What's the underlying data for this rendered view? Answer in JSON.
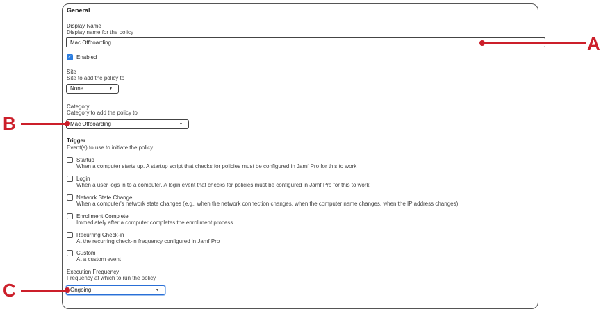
{
  "general": {
    "heading": "General",
    "display_name": {
      "label": "Display Name",
      "description": "Display name for the policy",
      "value": "Mac Offboarding"
    },
    "enabled": {
      "label": "Enabled",
      "checked": true
    },
    "site": {
      "label": "Site",
      "description": "Site to add the policy to",
      "selected": "None"
    },
    "category": {
      "label": "Category",
      "description": "Category to add the policy to",
      "selected": "Mac Offboarding"
    },
    "trigger": {
      "heading": "Trigger",
      "description": "Event(s) to use to initiate the policy",
      "options": [
        {
          "label": "Startup",
          "description": "When a computer starts up. A startup script that checks for policies must be configured in Jamf Pro for this to work",
          "checked": false
        },
        {
          "label": "Login",
          "description": "When a user logs in to a computer. A login event that checks for policies must be configured in Jamf Pro for this to work",
          "checked": false
        },
        {
          "label": "Network State Change",
          "description": "When a computer's network state changes (e.g., when the network connection changes, when the computer name changes, when the IP address changes)",
          "checked": false
        },
        {
          "label": "Enrollment Complete",
          "description": "Immediately after a computer completes the enrollment process",
          "checked": false
        },
        {
          "label": "Recurring Check-in",
          "description": "At the recurring check-in frequency configured in Jamf Pro",
          "checked": false
        },
        {
          "label": "Custom",
          "description": "At a custom event",
          "checked": false
        }
      ]
    },
    "execution_frequency": {
      "label": "Execution Frequency",
      "description": "Frequency at which to run the policy",
      "selected": "Ongoing"
    }
  },
  "annotations": {
    "a": "A",
    "b": "B",
    "c": "C",
    "color": "#cc1f2a"
  },
  "icons": {
    "select_caret": "▼",
    "check": "✓"
  }
}
